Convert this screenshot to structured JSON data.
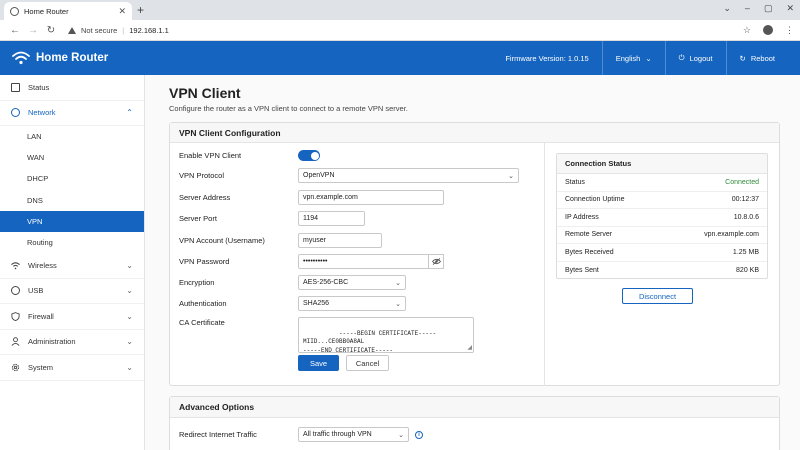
{
  "browser": {
    "tab_title": "Home Router",
    "tab_close": "✕",
    "new_tab": "+",
    "not_secure": "Not secure",
    "url": "192.168.1.1"
  },
  "header": {
    "title": "Home Router",
    "firmware": "Firmware Version: 1.0.15",
    "language": "English",
    "logout": "Logout",
    "reboot": "Reboot"
  },
  "sidebar": {
    "items": [
      {
        "label": "Status",
        "icon": "monitor-icon"
      },
      {
        "label": "Network",
        "icon": "globe-icon",
        "expanded": true,
        "children": [
          "LAN",
          "WAN",
          "DHCP",
          "DNS",
          "VPN",
          "Routing"
        ],
        "active_child": "VPN"
      },
      {
        "label": "Wireless",
        "icon": "wifi-icon"
      },
      {
        "label": "USB",
        "icon": "usb-icon"
      },
      {
        "label": "Firewall",
        "icon": "shield-icon"
      },
      {
        "label": "Administration",
        "icon": "user-icon"
      },
      {
        "label": "System",
        "icon": "gear-icon"
      }
    ]
  },
  "page": {
    "title": "VPN Client",
    "description": "Configure the router as a VPN client to connect to a remote VPN server."
  },
  "config": {
    "title": "VPN Client Configuration",
    "enable_label": "Enable VPN Client",
    "enabled": true,
    "protocol_label": "VPN Protocol",
    "protocol_value": "OpenVPN",
    "server_label": "Server Address",
    "server_value": "vpn.example.com",
    "port_label": "Server Port",
    "port_value": "1194",
    "account_label": "VPN Account (Username)",
    "account_value": "myuser",
    "password_label": "VPN Password",
    "password_value": "••••••••••",
    "encryption_label": "Encryption",
    "encryption_value": "AES-256-CBC",
    "auth_label": "Authentication",
    "auth_value": "SHA256",
    "cert_label": "CA Certificate",
    "cert_value": "-----BEGIN CERTIFICATE-----\nMIID...CE0BB0A8AL\n-----END CERTIFICATE-----",
    "save_label": "Save",
    "cancel_label": "Cancel"
  },
  "status": {
    "title": "Connection Status",
    "rows": [
      {
        "label": "Status",
        "value": "Connected"
      },
      {
        "label": "Connection Uptime",
        "value": "00:12:37"
      },
      {
        "label": "IP Address",
        "value": "10.8.0.6"
      },
      {
        "label": "Remote Server",
        "value": "vpn.example.com"
      },
      {
        "label": "Bytes Received",
        "value": "1.25 MB"
      },
      {
        "label": "Bytes Sent",
        "value": "820 KB"
      }
    ],
    "disconnect_label": "Disconnect"
  },
  "advanced": {
    "title": "Advanced Options",
    "redirect_label": "Redirect Internet Traffic",
    "redirect_value": "All traffic through VPN"
  },
  "colors": {
    "brand": "#1565c0",
    "connected": "#2e8b3a"
  }
}
